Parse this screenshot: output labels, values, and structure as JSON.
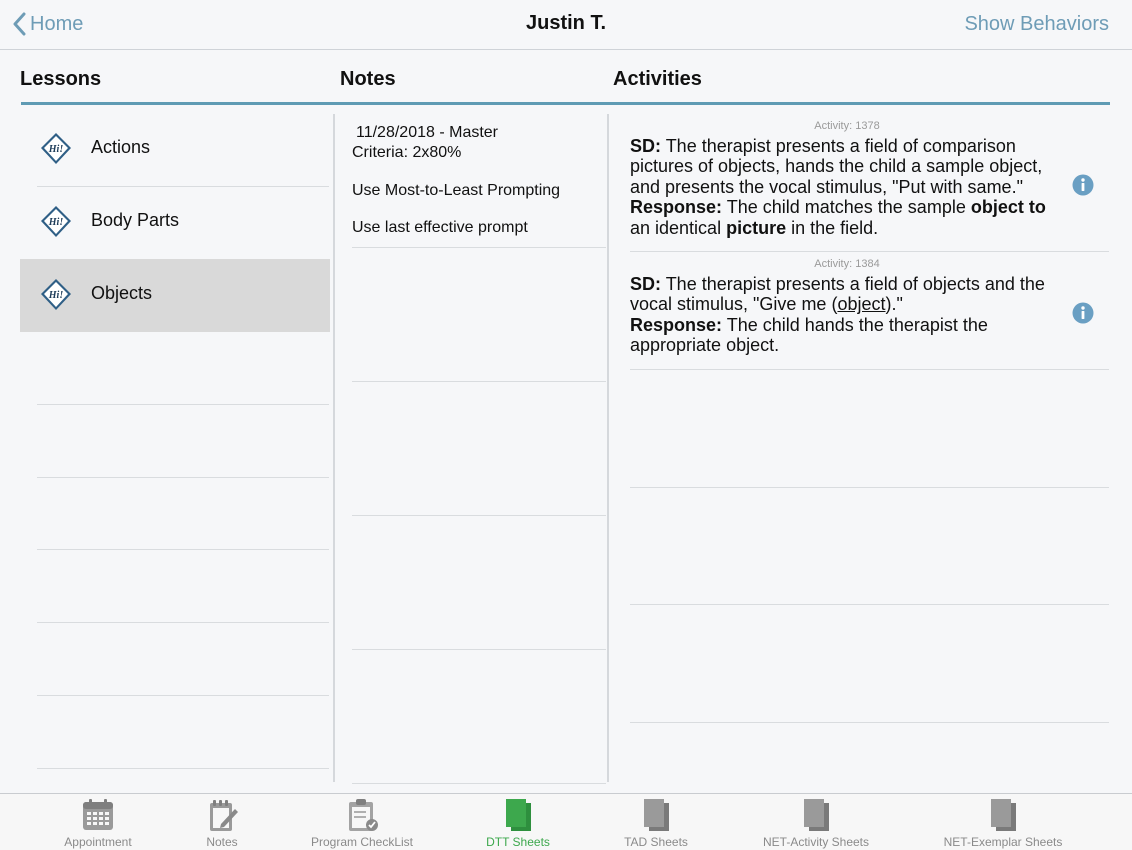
{
  "nav": {
    "back_label": "Home",
    "title": "Justin T.",
    "right_action": "Show Behaviors"
  },
  "columns": {
    "lessons": "Lessons",
    "notes": "Notes",
    "activities": "Activities"
  },
  "lessons": [
    {
      "label": "Actions",
      "icon": "hi-speech-icon",
      "selected": false
    },
    {
      "label": "Body Parts",
      "icon": "hi-speech-icon",
      "selected": false
    },
    {
      "label": "Objects",
      "icon": "hi-speech-icon",
      "selected": true
    }
  ],
  "notes": [
    {
      "line1": "11/28/2018 - Master",
      "line2": "Criteria: 2x80%"
    },
    {
      "text": "Use Most-to-Least Prompting"
    },
    {
      "text": "Use last effective prompt"
    }
  ],
  "activities": [
    {
      "id": "Activity: 1378",
      "sd_label": "SD:",
      "sd_text": "The therapist presents a field of comparison pictures of objects, hands the child a sample object, and presents the vocal stimulus, \"Put with same.\"",
      "response_label": "Response:",
      "response_pre": "The child matches the sample",
      "response_bold1": "object to",
      "response_mid": "an identical",
      "response_bold2": "picture",
      "response_post": "in the field."
    },
    {
      "id": "Activity: 1384",
      "sd_label": "SD:",
      "sd_text_pre": "The therapist presents a field of objects and the vocal stimulus, \"Give me (",
      "sd_text_underline": "object",
      "sd_text_post": ").\"",
      "response_label": "Response:",
      "response_text": "The child hands the therapist the appropriate object."
    }
  ],
  "tabs": [
    {
      "label": "Appointment",
      "icon": "calendar-icon",
      "active": false
    },
    {
      "label": "Notes",
      "icon": "notepad-icon",
      "active": false
    },
    {
      "label": "Program CheckList",
      "icon": "clipboard-check-icon",
      "active": false
    },
    {
      "label": "DTT Sheets",
      "icon": "sheets-icon",
      "active": true
    },
    {
      "label": "TAD Sheets",
      "icon": "sheets-icon",
      "active": false
    },
    {
      "label": "NET-Activity Sheets",
      "icon": "sheets-icon",
      "active": false
    },
    {
      "label": "NET-Exemplar Sheets",
      "icon": "sheets-icon",
      "active": false
    }
  ],
  "colors": {
    "accent": "#6e9cb6",
    "header_rule": "#5f9bb4",
    "active_tab": "#3da84d",
    "selected_row": "#d9d9d9",
    "info_icon": "#6a9fc3"
  }
}
